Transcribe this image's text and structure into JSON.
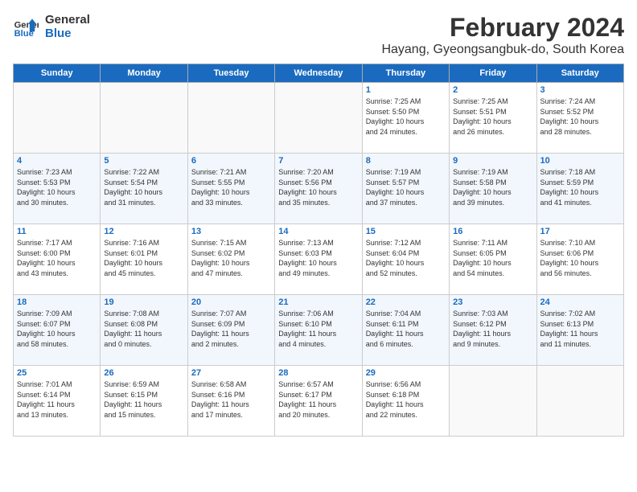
{
  "header": {
    "logo_line1": "General",
    "logo_line2": "Blue",
    "month": "February 2024",
    "location": "Hayang, Gyeongsangbuk-do, South Korea"
  },
  "weekdays": [
    "Sunday",
    "Monday",
    "Tuesday",
    "Wednesday",
    "Thursday",
    "Friday",
    "Saturday"
  ],
  "weeks": [
    [
      {
        "day": "",
        "info": ""
      },
      {
        "day": "",
        "info": ""
      },
      {
        "day": "",
        "info": ""
      },
      {
        "day": "",
        "info": ""
      },
      {
        "day": "1",
        "info": "Sunrise: 7:25 AM\nSunset: 5:50 PM\nDaylight: 10 hours\nand 24 minutes."
      },
      {
        "day": "2",
        "info": "Sunrise: 7:25 AM\nSunset: 5:51 PM\nDaylight: 10 hours\nand 26 minutes."
      },
      {
        "day": "3",
        "info": "Sunrise: 7:24 AM\nSunset: 5:52 PM\nDaylight: 10 hours\nand 28 minutes."
      }
    ],
    [
      {
        "day": "4",
        "info": "Sunrise: 7:23 AM\nSunset: 5:53 PM\nDaylight: 10 hours\nand 30 minutes."
      },
      {
        "day": "5",
        "info": "Sunrise: 7:22 AM\nSunset: 5:54 PM\nDaylight: 10 hours\nand 31 minutes."
      },
      {
        "day": "6",
        "info": "Sunrise: 7:21 AM\nSunset: 5:55 PM\nDaylight: 10 hours\nand 33 minutes."
      },
      {
        "day": "7",
        "info": "Sunrise: 7:20 AM\nSunset: 5:56 PM\nDaylight: 10 hours\nand 35 minutes."
      },
      {
        "day": "8",
        "info": "Sunrise: 7:19 AM\nSunset: 5:57 PM\nDaylight: 10 hours\nand 37 minutes."
      },
      {
        "day": "9",
        "info": "Sunrise: 7:19 AM\nSunset: 5:58 PM\nDaylight: 10 hours\nand 39 minutes."
      },
      {
        "day": "10",
        "info": "Sunrise: 7:18 AM\nSunset: 5:59 PM\nDaylight: 10 hours\nand 41 minutes."
      }
    ],
    [
      {
        "day": "11",
        "info": "Sunrise: 7:17 AM\nSunset: 6:00 PM\nDaylight: 10 hours\nand 43 minutes."
      },
      {
        "day": "12",
        "info": "Sunrise: 7:16 AM\nSunset: 6:01 PM\nDaylight: 10 hours\nand 45 minutes."
      },
      {
        "day": "13",
        "info": "Sunrise: 7:15 AM\nSunset: 6:02 PM\nDaylight: 10 hours\nand 47 minutes."
      },
      {
        "day": "14",
        "info": "Sunrise: 7:13 AM\nSunset: 6:03 PM\nDaylight: 10 hours\nand 49 minutes."
      },
      {
        "day": "15",
        "info": "Sunrise: 7:12 AM\nSunset: 6:04 PM\nDaylight: 10 hours\nand 52 minutes."
      },
      {
        "day": "16",
        "info": "Sunrise: 7:11 AM\nSunset: 6:05 PM\nDaylight: 10 hours\nand 54 minutes."
      },
      {
        "day": "17",
        "info": "Sunrise: 7:10 AM\nSunset: 6:06 PM\nDaylight: 10 hours\nand 56 minutes."
      }
    ],
    [
      {
        "day": "18",
        "info": "Sunrise: 7:09 AM\nSunset: 6:07 PM\nDaylight: 10 hours\nand 58 minutes."
      },
      {
        "day": "19",
        "info": "Sunrise: 7:08 AM\nSunset: 6:08 PM\nDaylight: 11 hours\nand 0 minutes."
      },
      {
        "day": "20",
        "info": "Sunrise: 7:07 AM\nSunset: 6:09 PM\nDaylight: 11 hours\nand 2 minutes."
      },
      {
        "day": "21",
        "info": "Sunrise: 7:06 AM\nSunset: 6:10 PM\nDaylight: 11 hours\nand 4 minutes."
      },
      {
        "day": "22",
        "info": "Sunrise: 7:04 AM\nSunset: 6:11 PM\nDaylight: 11 hours\nand 6 minutes."
      },
      {
        "day": "23",
        "info": "Sunrise: 7:03 AM\nSunset: 6:12 PM\nDaylight: 11 hours\nand 9 minutes."
      },
      {
        "day": "24",
        "info": "Sunrise: 7:02 AM\nSunset: 6:13 PM\nDaylight: 11 hours\nand 11 minutes."
      }
    ],
    [
      {
        "day": "25",
        "info": "Sunrise: 7:01 AM\nSunset: 6:14 PM\nDaylight: 11 hours\nand 13 minutes."
      },
      {
        "day": "26",
        "info": "Sunrise: 6:59 AM\nSunset: 6:15 PM\nDaylight: 11 hours\nand 15 minutes."
      },
      {
        "day": "27",
        "info": "Sunrise: 6:58 AM\nSunset: 6:16 PM\nDaylight: 11 hours\nand 17 minutes."
      },
      {
        "day": "28",
        "info": "Sunrise: 6:57 AM\nSunset: 6:17 PM\nDaylight: 11 hours\nand 20 minutes."
      },
      {
        "day": "29",
        "info": "Sunrise: 6:56 AM\nSunset: 6:18 PM\nDaylight: 11 hours\nand 22 minutes."
      },
      {
        "day": "",
        "info": ""
      },
      {
        "day": "",
        "info": ""
      }
    ]
  ]
}
